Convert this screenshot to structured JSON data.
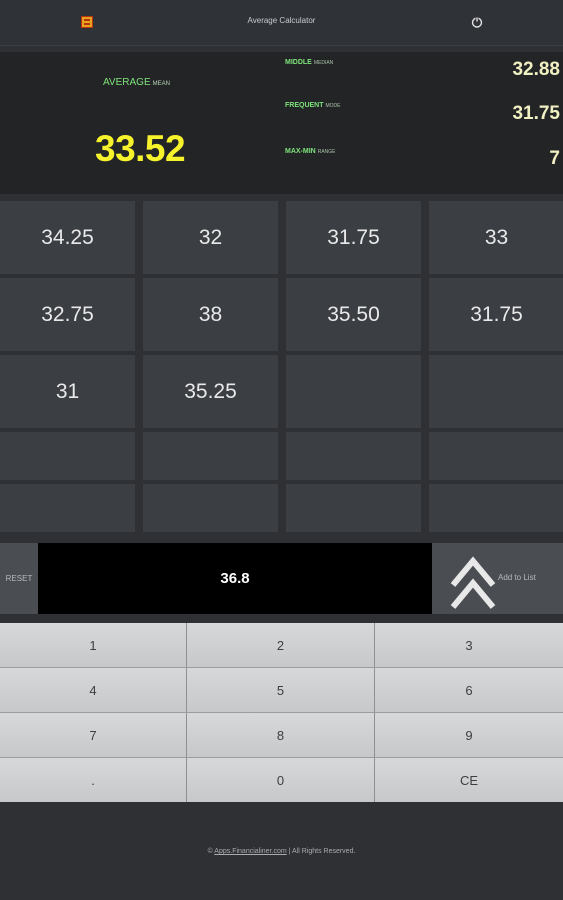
{
  "titlebar": {
    "title": "Average Calculator",
    "app_icon": "calculator-app-icon",
    "power_icon": "power-icon"
  },
  "stats": {
    "average_label": "AVERAGE",
    "average_sub": "MEAN",
    "average_value": "33.52",
    "middle_label": "MIDDLE",
    "middle_sub": "MEDIAN",
    "middle_value": "32.88",
    "frequent_label": "FREQUENT",
    "frequent_sub": "MODE",
    "frequent_value": "31.75",
    "maxmin_label": "MAX-MIN",
    "maxmin_sub": "RANGE",
    "maxmin_value": "7"
  },
  "list": {
    "cells": [
      "34.25",
      "32",
      "31.75",
      "33",
      "32.75",
      "38",
      "35.50",
      "31.75",
      "31",
      "35.25",
      "",
      "",
      "",
      "",
      "",
      "",
      "",
      "",
      "",
      ""
    ]
  },
  "entry": {
    "reset_label": "RESET",
    "value": "36.8",
    "add_label": "Add to List"
  },
  "keypad": {
    "keys": [
      "1",
      "2",
      "3",
      "4",
      "5",
      "6",
      "7",
      "8",
      "9",
      ".",
      "0",
      "CE"
    ]
  },
  "footer": {
    "copyright_symbol": "©",
    "link": "Apps.Financialiner.com",
    "rights": "| All Rights Reserved."
  },
  "colors": {
    "accent_green": "#7ee37b",
    "average_yellow": "#f6f22c",
    "background": "#2e3034"
  }
}
